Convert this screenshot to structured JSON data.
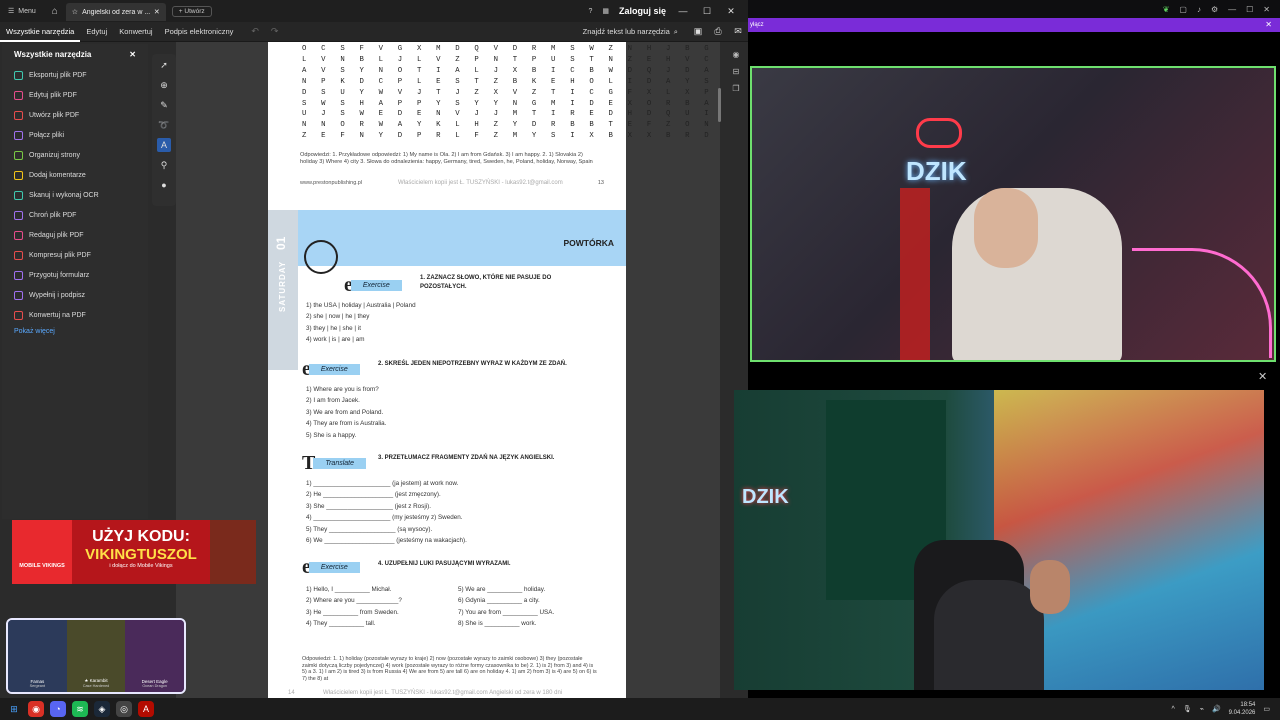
{
  "titlebar": {
    "menu_label": "Menu",
    "tab_title": "Angielski od zera w ...",
    "new_tab_label": "+ Utwórz",
    "sign_in": "Zaloguj się"
  },
  "toolbar": {
    "tabs": [
      "Wszystkie narzędzia",
      "Edytuj",
      "Konwertuj",
      "Podpis elektroniczny"
    ],
    "search_label": "Znajdź tekst lub narzędzia"
  },
  "sidebar": {
    "title": "Wszystkie narzędzia",
    "items": [
      {
        "label": "Eksportuj plik PDF",
        "color": "#3fc9b0"
      },
      {
        "label": "Edytuj plik PDF",
        "color": "#e84d8a"
      },
      {
        "label": "Utwórz plik PDF",
        "color": "#e84d4d"
      },
      {
        "label": "Połącz pliki",
        "color": "#a070f0"
      },
      {
        "label": "Organizuj strony",
        "color": "#7ac943"
      },
      {
        "label": "Dodaj komentarze",
        "color": "#f5c518"
      },
      {
        "label": "Skanuj i wykonaj OCR",
        "color": "#3fc9b0"
      },
      {
        "label": "Chroń plik PDF",
        "color": "#a070f0"
      },
      {
        "label": "Redaguj plik PDF",
        "color": "#e84d8a"
      },
      {
        "label": "Kompresuj plik PDF",
        "color": "#e84d4d"
      },
      {
        "label": "Przygotuj formularz",
        "color": "#a070f0"
      },
      {
        "label": "Wypełnij i podpisz",
        "color": "#a070f0"
      },
      {
        "label": "Konwertuj na PDF",
        "color": "#e84d4d"
      }
    ],
    "show_more": "Pokaż więcej"
  },
  "page1": {
    "grid_rows": [
      "O C S F V G X M D Q V D R M S W Z N H J B G I R Z A",
      "L V N B L J L V Z P N T P U S T N Z E H V C R W S J T",
      "A V S Y N O T I A L J X B I C B W D Q J D A R Z Q R T",
      "N P K D C P L E S T Z B K E H O L I D A Y S W E Q X Q",
      "D S U Y W V J T J Z X V Z T I C G F X L X P R Z A D G",
      "S W S H A P P Y S Y Y N G M I D E X O R B A B Q H V V",
      "U J S W E D E N V J J M T I R E D H D Q U I J I K P",
      "N N O R W A Y K L H Z Y D R B B T E F Z O N P G A T W",
      "Z E F N Y D P R L F Z M Y S I X B X X B R D L B O I A"
    ],
    "answers": "Odpowiedzi: 1. Przykładowe odpowiedzi: 1) My name is Ola. 2) I am from Gdańsk. 3) I am happy. 2. 1) Slovakia 2) holiday 3) Where 4) city 3. Słowa do odnalezienia: happy, Germany, tired, Sweden, he, Poland, holiday, Norway, Spain",
    "footer_left": "www.prestonpublishing.pl",
    "watermark": "Właścicielem kopii jest Ł. TUSZYŃSKI - lukas92.t@gmail.com",
    "page_number": "13"
  },
  "page2": {
    "unit": "01",
    "day": "SATURDAY",
    "title": "POWTÓRKA",
    "ex1": {
      "badge": "Exercise",
      "title": "1. ZAZNACZ SŁOWO, KTÓRE NIE PASUJE DO POZOSTAŁYCH.",
      "items": [
        "1)  the USA | holiday | Australia | Poland",
        "2)  she | now | he | they",
        "3)  they | he | she | it",
        "4)  work | is | are | am"
      ]
    },
    "ex2": {
      "badge": "Exercise",
      "title": "2. SKREŚL JEDEN NIEPOTRZEBNY WYRAZ W KAŻDYM ZE ZDAŃ.",
      "items": [
        "1)  Where are you is from?",
        "2)  I am from Jacek.",
        "3)  We are from and Poland.",
        "4)  They are from is Australia.",
        "5)  She is a happy."
      ]
    },
    "ex3": {
      "badge": "Translate",
      "title": "3. PRZETŁUMACZ FRAGMENTY ZDAŃ NA JĘZYK ANGIELSKI.",
      "items": [
        "1)  ______________________ (ja jestem) at work now.",
        "2)  He ____________________ (jest zmęczony).",
        "3)  She ___________________ (jest z Rosji).",
        "4)  ______________________ (my jesteśmy z) Sweden.",
        "5)  They ___________________ (są wysocy).",
        "6)  We ____________________ (jesteśmy na wakacjach)."
      ]
    },
    "ex4": {
      "badge": "Exercise",
      "title": "4. UZUPEŁNIJ LUKI PASUJĄCYMI WYRAZAMI.",
      "left": [
        "1)  Hello, I __________ Michał.",
        "2)  Where are you ____________?",
        "3)  He __________ from Sweden.",
        "4)  They __________ tall."
      ],
      "right": [
        "5)  We are __________ holiday.",
        "6)  Gdynia __________ a city.",
        "7)  You are from __________ USA.",
        "8)  She is __________ work."
      ]
    },
    "answers": "Odpowiedzi: 1. 1) holiday (pozostałe wyrazy to kraje) 2) now (pozostałe wyrazy to zaimki osobowe) 3) they (pozostałe zaimki dotyczą liczby pojedynczej) 4) work (pozostałe wyrazy to różne formy czasownika to be) 2. 1) is 2) from 3) and 4) is 5) a 3. 1) I am 2) is tired 3) is from Russia 4) We are from 5) are tall 6) are on holiday 4. 1) am 2) from 3) is 4) are 5) on 6) is 7) the 8) at",
    "footer_left": "14",
    "watermark": "Właścicielem kopii jest Ł. TUSZYŃSKI - lukas92.t@gmail.com",
    "footer_right": "Angielski od zera w 180 dni"
  },
  "promo": {
    "brand": "MOBILE VIKINGS",
    "line1": "UŻYJ KODU:",
    "line2": "VIKINGTUSZOL",
    "line3": "i dołącz do Mobile Vikings"
  },
  "skins": [
    {
      "name": "Famas",
      "sub": "Sergeant"
    },
    {
      "name": "★ Karambit",
      "sub": "Case Hardened"
    },
    {
      "name": "Desert Eagle",
      "sub": "Ocean Dragon"
    }
  ],
  "stream": {
    "bar_label": "yłącz",
    "cam1_sign": "DZIK",
    "cam2_sign": "DZIK"
  },
  "taskbar": {
    "time": "18:54",
    "date": "9.04.2026"
  }
}
